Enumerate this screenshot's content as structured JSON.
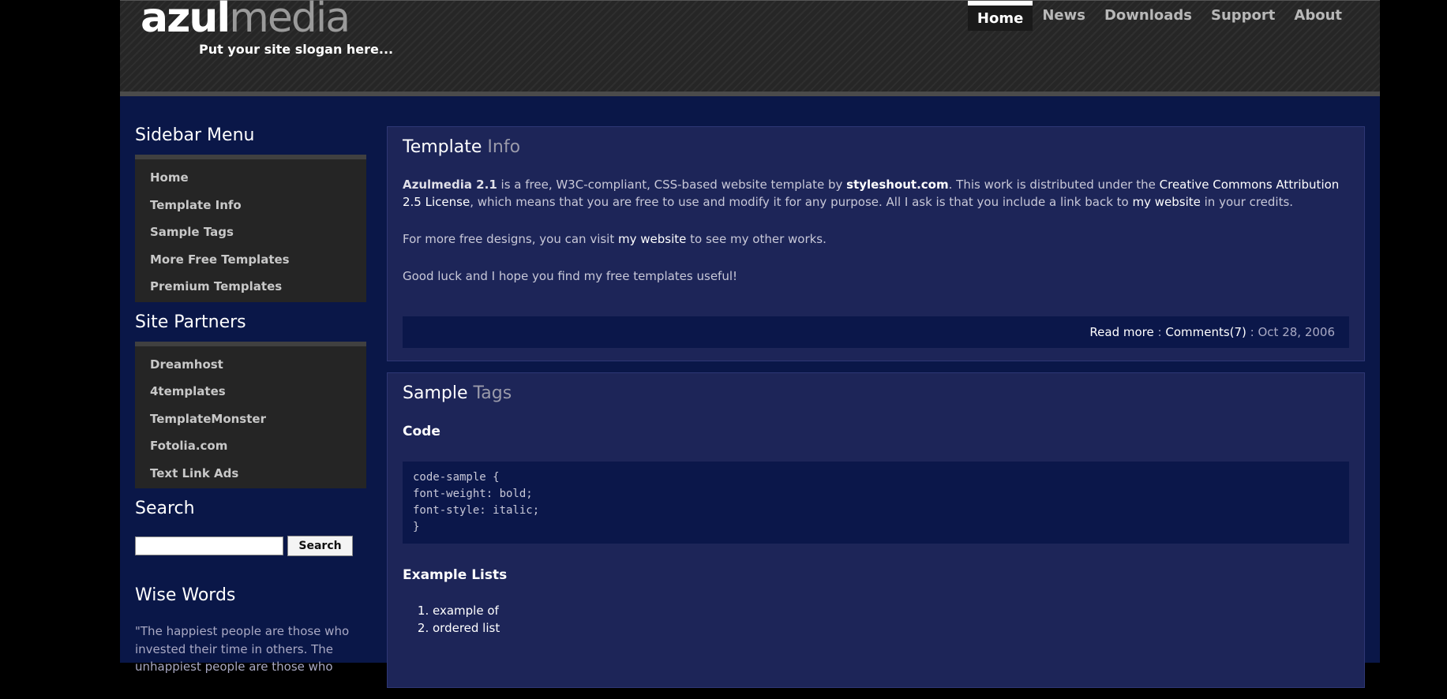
{
  "header": {
    "logo_part1": "azul",
    "logo_part2": "media",
    "slogan": "Put your site slogan here..."
  },
  "nav": {
    "items": [
      {
        "label": "Home",
        "active": true
      },
      {
        "label": "News"
      },
      {
        "label": "Downloads"
      },
      {
        "label": "Support"
      },
      {
        "label": "About"
      }
    ]
  },
  "sidebar": {
    "menu_title": "Sidebar Menu",
    "menu_items": [
      "Home",
      "Template Info",
      "Sample Tags",
      "More Free Templates",
      "Premium Templates"
    ],
    "partners_title": "Site Partners",
    "partners_items": [
      "Dreamhost",
      "4templates",
      "TemplateMonster",
      "Fotolia.com",
      "Text Link Ads"
    ],
    "search_title": "Search",
    "search_value": "",
    "search_button": "Search",
    "wise_title": "Wise Words",
    "wise_text": "\"The happiest people are those who invested their time in others. The unhappiest people are those who"
  },
  "post1": {
    "title_main": "Template",
    "title_dim": "Info",
    "p1_bold": "Azulmedia 2.1",
    "p1_a": " is a free, W3C-compliant, CSS-based website template by ",
    "p1_link1": "styleshout.com",
    "p1_b": ". This work is distributed under the ",
    "p1_link2": "Creative Commons Attribution 2.5 License",
    "p1_c": ", which means that you are free to use and modify it for any purpose. All I ask is that you include a link back to ",
    "p1_link3": "my website",
    "p1_d": " in your credits.",
    "p2_a": "For more free designs, you can visit ",
    "p2_link": "my website",
    "p2_b": " to see my other works.",
    "p3": "Good luck and I hope you find my free templates useful!",
    "footer_read_more": "Read more",
    "footer_sep1": " : ",
    "footer_comments": "Comments(7)",
    "footer_sep2": " : ",
    "footer_date": "Oct 28, 2006"
  },
  "post2": {
    "title_main": "Sample",
    "title_dim": "Tags",
    "code_heading": "Code",
    "code_lines": [
      "code-sample {",
      "font-weight: bold;",
      "font-style: italic;",
      "}"
    ],
    "lists_heading": "Example Lists",
    "ordered_list": [
      "example of",
      "ordered list"
    ]
  }
}
